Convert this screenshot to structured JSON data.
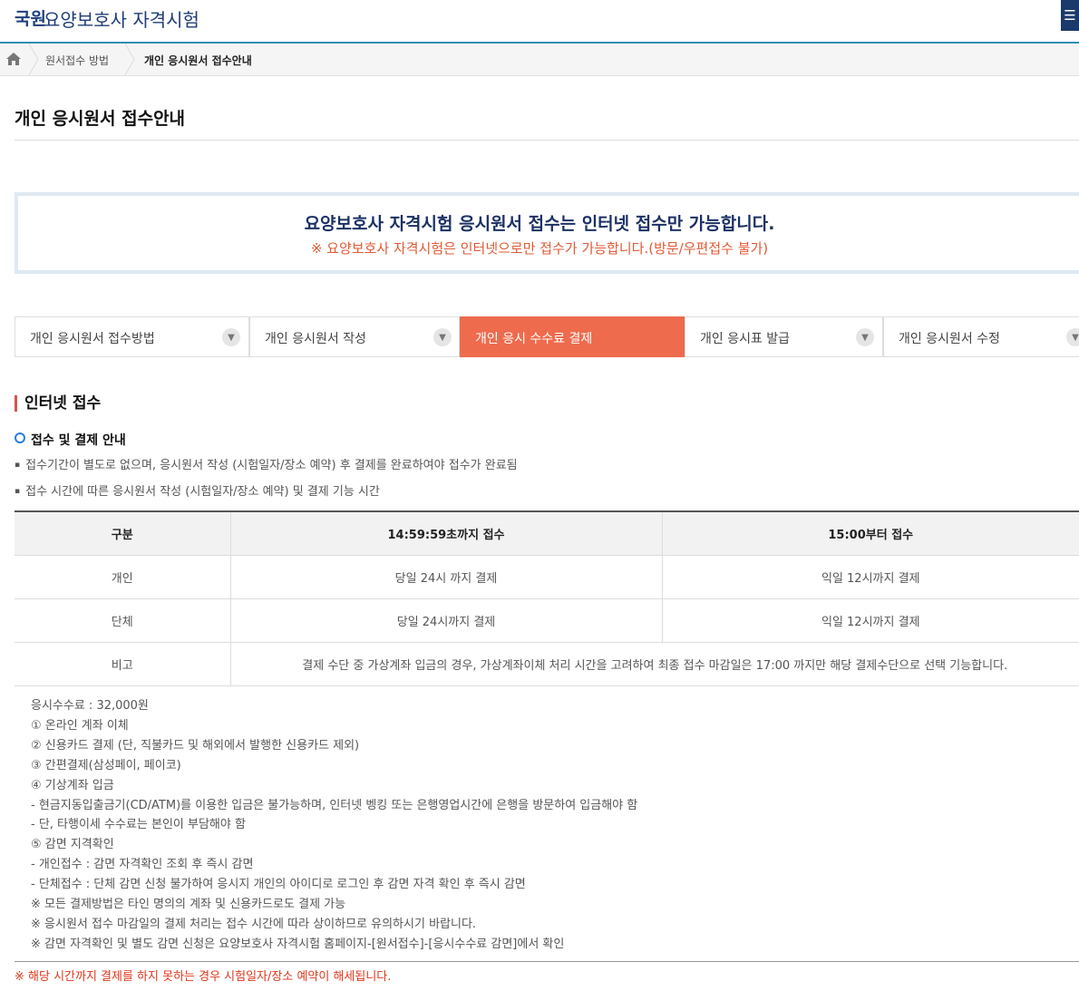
{
  "header": {
    "logo_text": "국원",
    "site_title": "요양보호사 자격시험",
    "menu_icon": "hamburger-icon"
  },
  "breadcrumb": {
    "home_icon": "home-icon",
    "items": [
      "원서접수 방법",
      "개인 응시원서 접수안내"
    ]
  },
  "page_title": "개인 응시원서 접수안내",
  "notice": {
    "main": "요양보호사 자격시험 응시원서 접수는 인터넷 접수만 가능합니다.",
    "sub": "※ 요양보호사 자격시험은 인터넷으로만 접수가 가능합니다.(방문/우편접수 불가)"
  },
  "tabs": [
    {
      "label": "개인 응시원서 접수방법",
      "active": false
    },
    {
      "label": "개인 응시원서 작성",
      "active": false
    },
    {
      "label": "개인 응시 수수료 결제",
      "active": true
    },
    {
      "label": "개인 응시표 발급",
      "active": false
    },
    {
      "label": "개인 응시원서 수정",
      "active": false
    }
  ],
  "section": {
    "title": "인터넷 접수",
    "subtitle": "접수 및 결제 안내",
    "bullets": [
      "접수기간이 별도로 없으며, 응시원서 작성 (시험일자/장소 예약) 후 결제를 완료하여야 접수가 완료됨",
      "접수 시간에 따른 응시원서 작성 (시험일자/장소 예약) 및 결제 기능 시간"
    ]
  },
  "table": {
    "headers": [
      "구분",
      "14:59:59초까지 접수",
      "15:00부터 접수"
    ],
    "rows": [
      [
        "개인",
        "당일 24시 까지 결제",
        "익일 12시까지 결제"
      ],
      [
        "단체",
        "당일 24시까지 결제",
        "익일 12시까지 결제"
      ]
    ],
    "note_label": "비고",
    "note_text": "결제 수단 중 가상계좌 입금의 경우, 가상계좌이체 처리 시간을 고려하여 최종 접수 마감일은 17:00 까지만 해당 결제수단으로 선택 기능합니다."
  },
  "fee_notes": [
    "응시수수료 : 32,000원",
    "① 온라인 계좌 이체",
    "② 신용카드 결제 (단, 직불카드 및 해외에서 발행한 신용카드 제외)",
    "③ 간편결제(삼성페이, 페이코)",
    "④ 기상계좌 입금",
    "- 현금지동입출금기(CD/ATM)를 이용한 입금은 불가능하며, 인터넷 벵킹 또는 은행영업시간에 은행을 방문하여 입금해야 함",
    "- 단, 타행이세 수수료는 본인이 부담해야 함",
    "⑤ 감면 지격확인",
    "- 개인접수 : 감면 자격확인 조회 후 즉시 감면",
    "- 단체접수 : 단체 감면 신청 불가하여 응시지 개인의 아이디로 로그인 후 감면 자격 확인 후 즉시 감면",
    "※ 모든 결제방법은 타인 명의의 계좌 및 신용카드로도 결제 가능",
    "※ 응시원서 접수 마감일의 결제 처리는 접수 시간에 따라 상이하므로 유의하시기 바랍니다.",
    "※ 감면 자격확인 및 별도 감면 신청은 요양보호사 자격시험 홈페이지-[원서접수]-[응시수수료 감면]에서 확인"
  ],
  "warning": "※ 해당 시간까지 결제를 하지 못하는 경우 시험일자/장소 예약이 해세됩니다.",
  "colors": {
    "accent": "#ee6b4d",
    "navy": "#1c3164",
    "header_line": "#2f8fb0",
    "warning": "#e0361b"
  }
}
